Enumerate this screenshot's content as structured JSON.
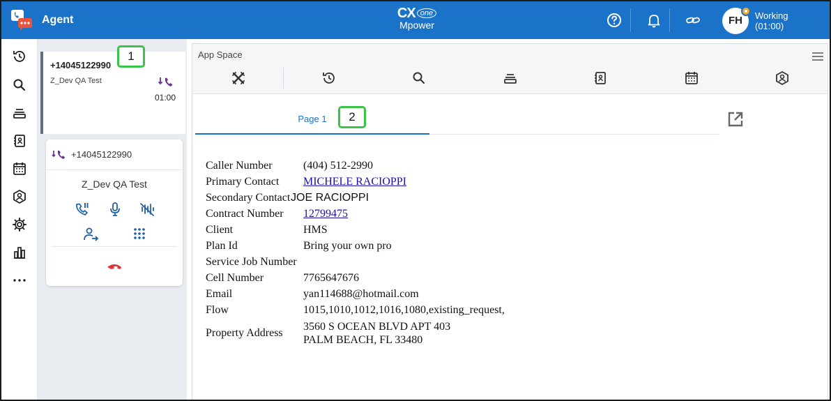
{
  "header": {
    "title": "Agent",
    "brand_top": "CX",
    "brand_one": "one",
    "brand_bottom": "Mpower",
    "avatar_initials": "FH",
    "status": "Working",
    "status_timer": "(01:00)",
    "colors": {
      "bar": "#1a73c8",
      "status_dot": "#f5a623"
    }
  },
  "nav_icons": [
    "history-icon",
    "search-icon",
    "queue-icon",
    "address-book-icon",
    "schedule-icon",
    "profile-icon",
    "settings-icon",
    "reports-icon",
    "more-icon"
  ],
  "interaction_tab": {
    "number": "+14045122990",
    "skill": "Z_Dev QA Test",
    "timer": "01:00"
  },
  "call_card": {
    "number": "+14045122990",
    "name": "Z_Dev QA Test",
    "controls": [
      "hold-icon",
      "mute-icon",
      "mask-icon",
      "transfer-icon",
      "dialpad-icon",
      "hang-up-icon"
    ]
  },
  "app_space": {
    "title": "App Space",
    "toolbar_icons": [
      "tools-icon",
      "history-icon",
      "search-icon",
      "queue-icon",
      "address-book-icon",
      "schedule-icon",
      "profile-icon"
    ],
    "tab_label": "Page 1"
  },
  "callouts": {
    "one": "1",
    "two": "2"
  },
  "record": [
    {
      "label": "Caller Number",
      "value": "(404) 512-2990",
      "style": "plain"
    },
    {
      "label": "Primary Contact",
      "value": "MICHELE RACIOPPI",
      "style": "link"
    },
    {
      "label": "Secondary Contact",
      "value": "JOE RACIOPPI",
      "style": "sans"
    },
    {
      "label": "Contract Number",
      "value": "12799475",
      "style": "link"
    },
    {
      "label": "Client",
      "value": "HMS",
      "style": "plain"
    },
    {
      "label": "Plan Id",
      "value": "Bring your own pro",
      "style": "plain"
    },
    {
      "label": "Service Job Number",
      "value": "",
      "style": "plain"
    },
    {
      "label": "Cell Number",
      "value": "7765647676",
      "style": "plain"
    },
    {
      "label": "Email",
      "value": "yan114688@hotmail.com",
      "style": "plain"
    },
    {
      "label": "Flow",
      "value": "1015,1010,1012,1016,1080,existing_request,",
      "style": "plain"
    }
  ],
  "property_address": {
    "label": "Property Address",
    "line1": "3560 S OCEAN BLVD APT 403",
    "line2": "PALM BEACH, FL 33480"
  }
}
